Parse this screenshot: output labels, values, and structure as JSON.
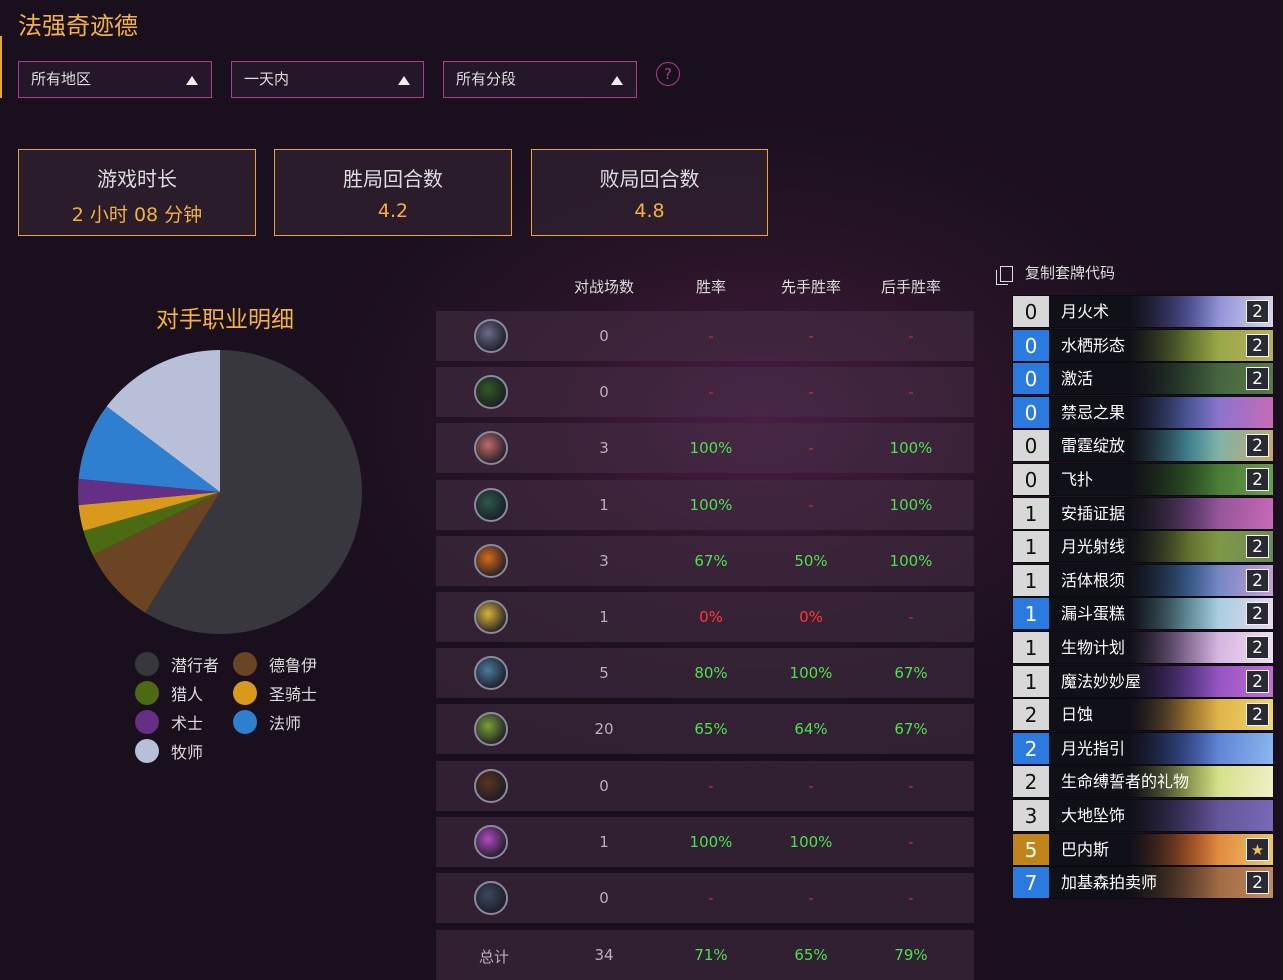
{
  "title": "法强奇迹德",
  "filters": [
    {
      "label": "所有地区"
    },
    {
      "label": "一天内"
    },
    {
      "label": "所有分段"
    }
  ],
  "help_label": "?",
  "stats": [
    {
      "label": "游戏时长",
      "value": "2 小时 08 分钟"
    },
    {
      "label": "胜局回合数",
      "value": "4.2"
    },
    {
      "label": "败局回合数",
      "value": "4.8"
    }
  ],
  "chart_data": {
    "type": "pie",
    "title": "对手职业明细",
    "slices": [
      {
        "name": "潜行者",
        "value": 20,
        "color": "#37373d"
      },
      {
        "name": "德鲁伊",
        "value": 3,
        "color": "#6b4423"
      },
      {
        "name": "猎人",
        "value": 1,
        "color": "#4b6a12"
      },
      {
        "name": "圣骑士",
        "value": 1,
        "color": "#d99a1c"
      },
      {
        "name": "术士",
        "value": 1,
        "color": "#642f84"
      },
      {
        "name": "法师",
        "value": 3,
        "color": "#2f7fd1"
      },
      {
        "name": "牧师",
        "value": 5,
        "color": "#b7bfd9"
      }
    ],
    "legend_position": "bottom"
  },
  "table": {
    "headers": [
      "对战场数",
      "胜率",
      "先手胜率",
      "后手胜率"
    ],
    "rows": [
      {
        "icon": "warrior-icon",
        "icon_color": "#6a6a88",
        "games": "0",
        "winrate": "-",
        "first": "-",
        "second": "-"
      },
      {
        "icon": "demon-hunter-icon",
        "icon_color": "#2f5a23",
        "games": "0",
        "winrate": "-",
        "first": "-",
        "second": "-"
      },
      {
        "icon": "mage-icon",
        "icon_color": "#c06a6a",
        "games": "3",
        "winrate": "100%",
        "first": "-",
        "second": "100%"
      },
      {
        "icon": "hunter-icon",
        "icon_color": "#2a5a48",
        "games": "1",
        "winrate": "100%",
        "first": "-",
        "second": "100%"
      },
      {
        "icon": "druid-icon",
        "icon_color": "#d86a1c",
        "games": "3",
        "winrate": "67%",
        "first": "50%",
        "second": "100%"
      },
      {
        "icon": "paladin-icon",
        "icon_color": "#d9b33c",
        "games": "1",
        "winrate": "0%",
        "first": "0%",
        "second": "-"
      },
      {
        "icon": "shaman-icon",
        "icon_color": "#4a7a9a",
        "games": "5",
        "winrate": "80%",
        "first": "100%",
        "second": "67%"
      },
      {
        "icon": "rogue-icon",
        "icon_color": "#7aa03a",
        "games": "20",
        "winrate": "65%",
        "first": "64%",
        "second": "67%"
      },
      {
        "icon": "warlock-icon",
        "icon_color": "#5a3420",
        "games": "0",
        "winrate": "-",
        "first": "-",
        "second": "-"
      },
      {
        "icon": "priest-icon",
        "icon_color": "#b04ac0",
        "games": "1",
        "winrate": "100%",
        "first": "100%",
        "second": "-"
      },
      {
        "icon": "death-knight-icon",
        "icon_color": "#3a4a60",
        "games": "0",
        "winrate": "-",
        "first": "-",
        "second": "-"
      }
    ],
    "total": {
      "label": "总计",
      "games": "34",
      "winrate": "71%",
      "first": "65%",
      "second": "79%"
    }
  },
  "copy_code_label": "复制套牌代码",
  "deck": [
    {
      "cost": "0",
      "name": "月火术",
      "count": "2",
      "rarity": "common",
      "art": [
        "#2c2a5e",
        "#6b6fc8",
        "#d8d6f0"
      ]
    },
    {
      "cost": "0",
      "name": "水栖形态",
      "count": "2",
      "rarity": "rare",
      "art": [
        "#3a4a22",
        "#8aa33a",
        "#b8b060"
      ]
    },
    {
      "cost": "0",
      "name": "激活",
      "count": "2",
      "rarity": "rare",
      "art": [
        "#1e2a1e",
        "#3a5a3a",
        "#5a7a4a"
      ]
    },
    {
      "cost": "0",
      "name": "禁忌之果",
      "count": "",
      "rarity": "rare",
      "art": [
        "#1e3a5a",
        "#6a7ad8",
        "#c86ab8"
      ]
    },
    {
      "cost": "0",
      "name": "雷霆绽放",
      "count": "2",
      "rarity": "common",
      "art": [
        "#3a5a6a",
        "#5ab8c8",
        "#c8a86a"
      ]
    },
    {
      "cost": "0",
      "name": "飞扑",
      "count": "2",
      "rarity": "common",
      "art": [
        "#1e3a1e",
        "#3a6a2a",
        "#6aa04a"
      ]
    },
    {
      "cost": "1",
      "name": "安插证据",
      "count": "",
      "rarity": "common",
      "art": [
        "#2a3a2a",
        "#7a4a8a",
        "#c86ab8"
      ]
    },
    {
      "cost": "1",
      "name": "月光射线",
      "count": "2",
      "rarity": "common",
      "art": [
        "#2a3a1e",
        "#8aa03a",
        "#6a8a5a"
      ]
    },
    {
      "cost": "1",
      "name": "活体根须",
      "count": "2",
      "rarity": "common",
      "art": [
        "#1e2a3a",
        "#4a7ab8",
        "#c8a0d8"
      ]
    },
    {
      "cost": "1",
      "name": "漏斗蛋糕",
      "count": "2",
      "rarity": "rare",
      "art": [
        "#3a5a6a",
        "#8ac8d8",
        "#e8d8f0"
      ]
    },
    {
      "cost": "1",
      "name": "生物计划",
      "count": "2",
      "rarity": "common",
      "art": [
        "#5a3a6a",
        "#c8a0d8",
        "#f0e0f0"
      ]
    },
    {
      "cost": "1",
      "name": "魔法妙妙屋",
      "count": "2",
      "rarity": "common",
      "art": [
        "#2a1e4a",
        "#7a4ab8",
        "#c86ad8"
      ]
    },
    {
      "cost": "2",
      "name": "日蚀",
      "count": "2",
      "rarity": "common",
      "art": [
        "#1e1e3a",
        "#d8a03a",
        "#f0d86a"
      ]
    },
    {
      "cost": "2",
      "name": "月光指引",
      "count": "",
      "rarity": "rare",
      "art": [
        "#1e2a5a",
        "#4a6ac8",
        "#8ab8f0"
      ]
    },
    {
      "cost": "2",
      "name": "生命缚誓者的礼物",
      "count": "",
      "rarity": "common",
      "art": [
        "#4a5a2a",
        "#c8d86a",
        "#f0f0c8"
      ]
    },
    {
      "cost": "3",
      "name": "大地坠饰",
      "count": "",
      "rarity": "common",
      "art": [
        "#2a2a4a",
        "#5a4a8a",
        "#7a6ab8"
      ]
    },
    {
      "cost": "5",
      "name": "巴内斯",
      "count": "★",
      "rarity": "legendary",
      "art": [
        "#3a1e1e",
        "#d86a2a",
        "#f0c86a"
      ]
    },
    {
      "cost": "7",
      "name": "加基森拍卖师",
      "count": "2",
      "rarity": "rare",
      "art": [
        "#3a2a1e",
        "#8a5a3a",
        "#c88a5a"
      ]
    }
  ]
}
